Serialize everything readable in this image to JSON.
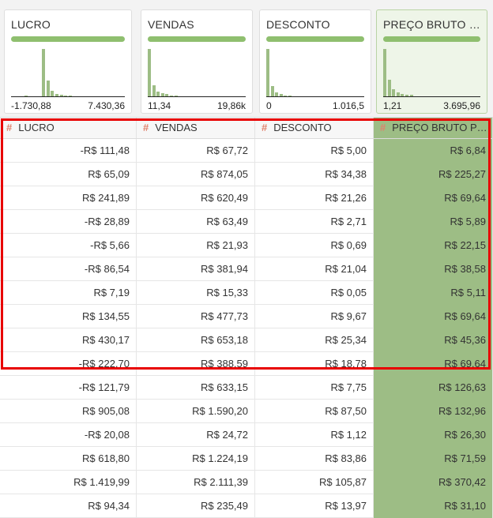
{
  "profile_cards": [
    {
      "title": "LUCRO",
      "min": "-1.730,88",
      "max": "7.430,36",
      "hist": [
        0,
        0,
        0,
        1,
        0,
        0,
        0,
        52,
        17,
        6,
        3,
        2,
        1,
        1,
        0,
        0,
        0,
        0,
        0,
        0,
        0
      ]
    },
    {
      "title": "VENDAS",
      "min": "11,34",
      "max": "19,86k",
      "hist": [
        48,
        11,
        5,
        3,
        2,
        1,
        1,
        0,
        0,
        0,
        0,
        0,
        0,
        0,
        0,
        0,
        0,
        0
      ]
    },
    {
      "title": "DESCONTO",
      "min": "0",
      "max": "1.016,5",
      "hist": [
        48,
        10,
        4,
        2,
        1,
        1,
        0,
        0,
        0,
        0,
        0,
        0,
        0,
        0,
        0,
        0,
        0,
        0,
        0
      ]
    },
    {
      "title": "PREÇO BRUTO POR UNIDADE",
      "min": "1,21",
      "max": "3.695,96",
      "hist": [
        40,
        14,
        6,
        3,
        2,
        1,
        1,
        0,
        0,
        0,
        0,
        0,
        0,
        0,
        0,
        0,
        0,
        0,
        0
      ],
      "selected": true
    }
  ],
  "columns": [
    {
      "label": "LUCRO",
      "type_icon": "#"
    },
    {
      "label": "VENDAS",
      "type_icon": "#"
    },
    {
      "label": "DESCONTO",
      "type_icon": "#"
    },
    {
      "label": "PREÇO BRUTO POR UNIDADE",
      "type_icon": "#",
      "selected": true
    }
  ],
  "rows": [
    [
      "-R$ 111,48",
      "R$ 67,72",
      "R$ 5,00",
      "R$ 6,84"
    ],
    [
      "R$ 65,09",
      "R$ 874,05",
      "R$ 34,38",
      "R$ 225,27"
    ],
    [
      "R$ 241,89",
      "R$ 620,49",
      "R$ 21,26",
      "R$ 69,64"
    ],
    [
      "-R$ 28,89",
      "R$ 63,49",
      "R$ 2,71",
      "R$ 5,89"
    ],
    [
      "-R$ 5,66",
      "R$ 21,93",
      "R$ 0,69",
      "R$ 22,15"
    ],
    [
      "-R$ 86,54",
      "R$ 381,94",
      "R$ 21,04",
      "R$ 38,58"
    ],
    [
      "R$ 7,19",
      "R$ 15,33",
      "R$ 0,05",
      "R$ 5,11"
    ],
    [
      "R$ 134,55",
      "R$ 477,73",
      "R$ 9,67",
      "R$ 69,64"
    ],
    [
      "R$ 430,17",
      "R$ 653,18",
      "R$ 25,34",
      "R$ 45,36"
    ],
    [
      "-R$ 222,70",
      "R$ 388,59",
      "R$ 18,78",
      "R$ 69,64"
    ],
    [
      "-R$ 121,79",
      "R$ 633,15",
      "R$ 7,75",
      "R$ 126,63"
    ],
    [
      "R$ 905,08",
      "R$ 1.590,20",
      "R$ 87,50",
      "R$ 132,96"
    ],
    [
      "-R$ 20,08",
      "R$ 24,72",
      "R$ 1,12",
      "R$ 26,30"
    ],
    [
      "R$ 618,80",
      "R$ 1.224,19",
      "R$ 83,86",
      "R$ 71,59"
    ],
    [
      "R$ 1.419,99",
      "R$ 2.111,39",
      "R$ 105,87",
      "R$ 370,42"
    ],
    [
      "R$ 94,34",
      "R$ 235,49",
      "R$ 13,97",
      "R$ 31,10"
    ]
  ],
  "colors": {
    "accent_green": "#9dbd85",
    "highlight_red": "#e80000",
    "type_icon": "#e0826d"
  }
}
